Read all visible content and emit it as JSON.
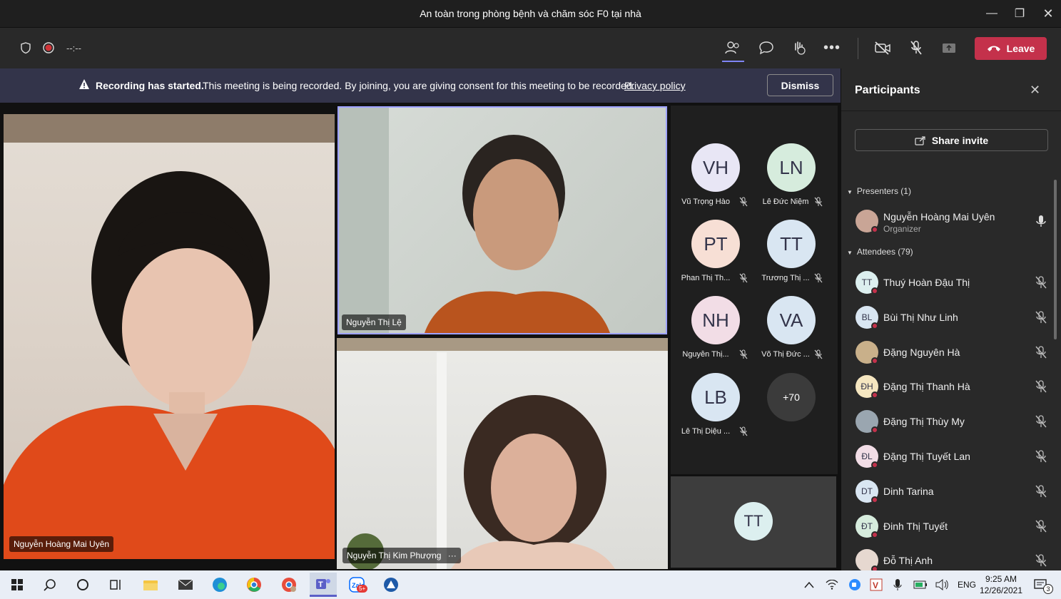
{
  "window": {
    "title": "An toàn trong phòng bệnh và chăm sóc F0 tại nhà"
  },
  "toolbar": {
    "timer": "--:--",
    "leave_label": "Leave"
  },
  "banner": {
    "bold": "Recording has started.",
    "text": "This meeting is being recorded. By joining, you are giving consent for this meeting to be recorded.",
    "link": "Privacy policy",
    "dismiss": "Dismiss"
  },
  "videos": {
    "main": "Nguyễn Hoàng Mai Uyên",
    "top": "Nguyễn Thị Lệ",
    "bottom": "Nguyễn Thị Kim Phượng",
    "bottom_more": "···"
  },
  "gallery": [
    {
      "initials": "VH",
      "name": "Vũ Trọng Hào",
      "color": "#e8e6f5"
    },
    {
      "initials": "LN",
      "name": "Lê Đức Niệm",
      "color": "#d6ecdd"
    },
    {
      "initials": "PT",
      "name": "Phan Thị Th...",
      "color": "#f7dfd5"
    },
    {
      "initials": "TT",
      "name": "Trương Thị ...",
      "color": "#d9e6f2"
    },
    {
      "initials": "NH",
      "name": "Nguyễn Thị...",
      "color": "#f2dde6"
    },
    {
      "initials": "VA",
      "name": "Võ Thị Đức ...",
      "color": "#d9e6f2"
    },
    {
      "initials": "LB",
      "name": "Lê Thị Diệu ...",
      "color": "#d9e6f2"
    }
  ],
  "overflow": "+70",
  "extra_tile": {
    "initials": "TT",
    "color": "#dcefef"
  },
  "panel": {
    "title": "Participants",
    "share": "Share invite",
    "presenters_header": "Presenters (1)",
    "presenter": {
      "name": "Nguyễn Hoàng Mai Uyên",
      "role": "Organizer"
    },
    "attendees_header": "Attendees (79)",
    "attendees": [
      {
        "initials": "TT",
        "name": "Thuý Hoàn Đậu Thị",
        "color": "#dcefef"
      },
      {
        "initials": "BL",
        "name": "Bùi Thị Như Linh",
        "color": "#d9e6f2"
      },
      {
        "initials": "",
        "name": "Đặng Nguyên Hà",
        "color": "#c9b08a"
      },
      {
        "initials": "ĐH",
        "name": "Đặng Thị Thanh Hà",
        "color": "#f5e6c0"
      },
      {
        "initials": "",
        "name": "Đặng Thị Thùy My",
        "color": "#9aa6b0"
      },
      {
        "initials": "ĐL",
        "name": "Đặng Thị Tuyết Lan",
        "color": "#f2dde6"
      },
      {
        "initials": "DT",
        "name": "Dinh Tarina",
        "color": "#d9e6f2"
      },
      {
        "initials": "ĐT",
        "name": "Đinh Thị Tuyết",
        "color": "#d6ecdd"
      },
      {
        "initials": "",
        "name": "Đỗ Thị Anh",
        "color": "#e6d8d0"
      }
    ]
  },
  "taskbar": {
    "lang": "ENG",
    "time": "9:25 AM",
    "date": "12/26/2021",
    "notif": "3",
    "zalo_badge": "5+"
  }
}
